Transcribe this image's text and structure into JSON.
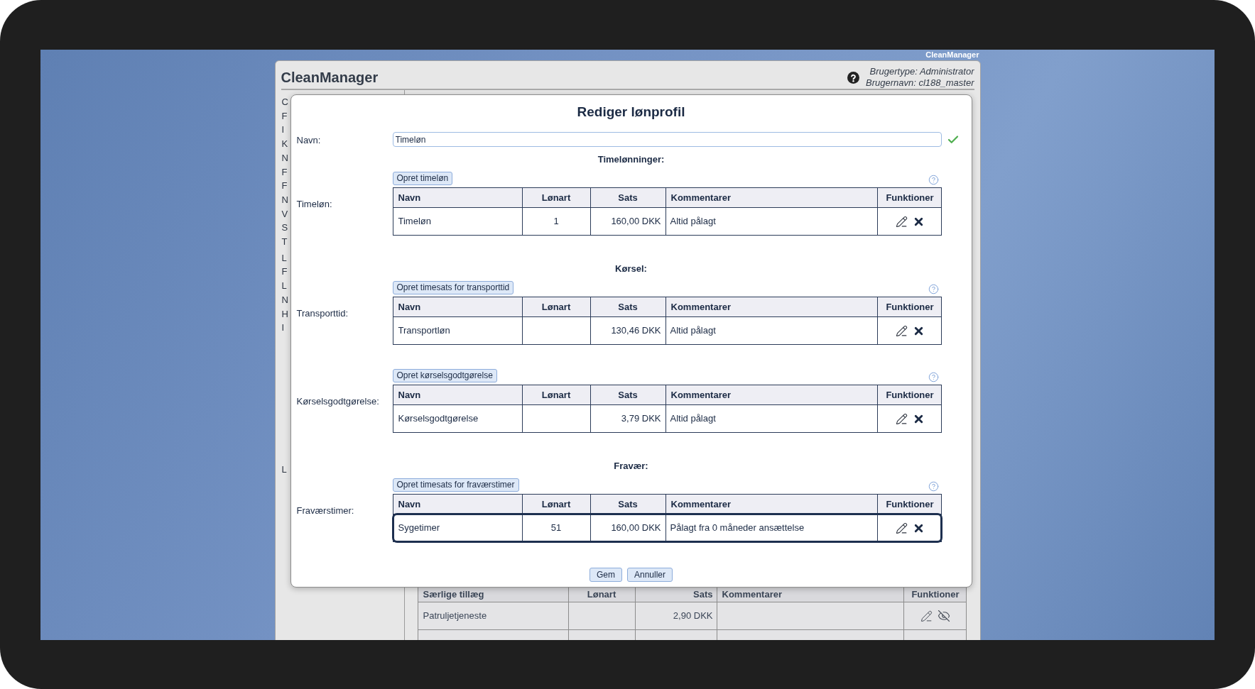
{
  "desktop": {
    "corner_label": "CleanManager"
  },
  "window": {
    "title": "CleanManager",
    "user_type": "Brugertype: Administrator",
    "user_name": "Brugernavn: cl188_master"
  },
  "sidebar": {
    "groups": [
      {
        "items": [
          "C",
          "F",
          "I",
          "K",
          "N",
          "F",
          "F",
          "N",
          "V",
          "S",
          "T"
        ]
      },
      {
        "items": [
          "L",
          "F",
          "L",
          "N",
          "H",
          "I"
        ]
      },
      {
        "items": [
          "L"
        ]
      }
    ]
  },
  "background_table": {
    "columns": [
      "Særlige tillæg",
      "Lønart",
      "Sats",
      "Kommentarer",
      "Funktioner"
    ],
    "rows": [
      {
        "name": "Patruljetjeneste",
        "rate": "2,90 DKK"
      }
    ]
  },
  "dialog": {
    "title": "Rediger lønprofil",
    "name_label": "Navn:",
    "name_value": "Timeløn",
    "name_valid": true,
    "groups": [
      {
        "heading": "Timelønninger:",
        "label": "Timeløn:",
        "create_button": "Opret timeløn",
        "columns": [
          "Navn",
          "Lønart",
          "Sats",
          "Kommentarer",
          "Funktioner"
        ],
        "rows": [
          {
            "name": "Timeløn",
            "wage_type": "1",
            "rate": "160,00 DKK",
            "comment": "Altid pålagt",
            "selected": false
          }
        ]
      },
      {
        "heading": "Kørsel:",
        "label": "Transporttid:",
        "create_button": "Opret timesats for transporttid",
        "columns": [
          "Navn",
          "Lønart",
          "Sats",
          "Kommentarer",
          "Funktioner"
        ],
        "rows": [
          {
            "name": "Transportløn",
            "rate": "130,46 DKK",
            "comment": "Altid pålagt",
            "selected": false
          }
        ]
      },
      {
        "label": "Kørselsgodtgørelse:",
        "create_button": "Opret kørselsgodtgørelse",
        "columns": [
          "Navn",
          "Lønart",
          "Sats",
          "Kommentarer",
          "Funktioner"
        ],
        "rows": [
          {
            "name": "Kørselsgodtgørelse",
            "rate": "3,79 DKK",
            "comment": "Altid pålagt",
            "selected": false
          }
        ]
      },
      {
        "heading": "Fravær:",
        "label": "Fraværstimer:",
        "create_button": "Opret timesats for fraværstimer",
        "columns": [
          "Navn",
          "Lønart",
          "Sats",
          "Kommentarer",
          "Funktioner"
        ],
        "rows": [
          {
            "name": "Sygetimer",
            "wage_type": "51",
            "rate": "160,00 DKK",
            "comment": "Pålagt fra 0 måneder ansættelse",
            "selected": true
          }
        ]
      }
    ],
    "buttons": [
      "Gem",
      "Annuller"
    ]
  }
}
